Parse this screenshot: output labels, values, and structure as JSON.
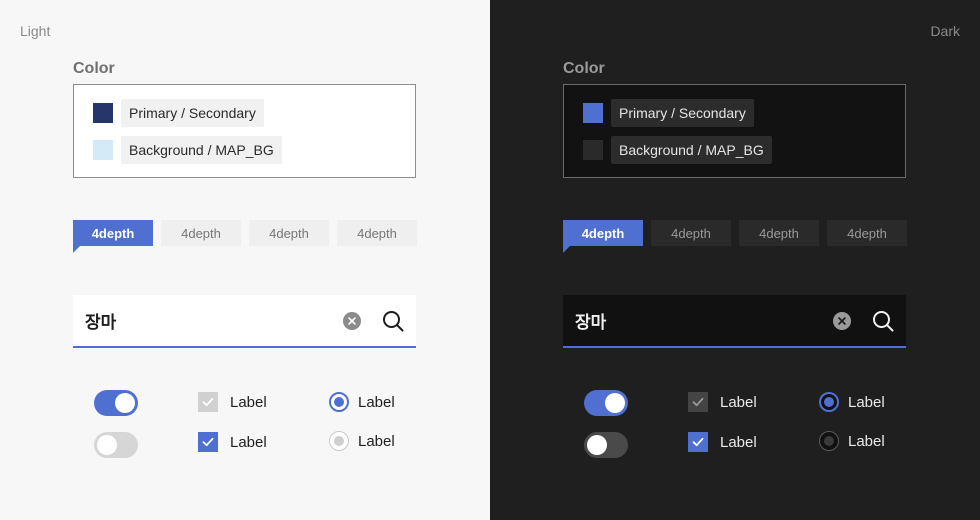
{
  "light": {
    "mode_label": "Light",
    "section_title": "Color",
    "swatches": [
      {
        "label": "Primary / Secondary",
        "color": "#27366a"
      },
      {
        "label": "Background / MAP_BG",
        "color": "#d4eaf6"
      }
    ],
    "tabs": [
      "4depth",
      "4depth",
      "4depth",
      "4depth"
    ],
    "active_tab": 0,
    "search": {
      "value": "장마"
    },
    "toggles": [
      {
        "on": true
      },
      {
        "on": false
      }
    ],
    "checkboxes": [
      {
        "label": "Label",
        "state": "disabled-checked"
      },
      {
        "label": "Label",
        "state": "checked"
      }
    ],
    "radios": [
      {
        "label": "Label",
        "selected": true
      },
      {
        "label": "Label",
        "selected": false
      }
    ]
  },
  "dark": {
    "mode_label": "Dark",
    "section_title": "Color",
    "swatches": [
      {
        "label": "Primary / Secondary",
        "color": "#4f6fd1"
      },
      {
        "label": "Background / MAP_BG",
        "color": "#2a2a2a"
      }
    ],
    "tabs": [
      "4depth",
      "4depth",
      "4depth",
      "4depth"
    ],
    "active_tab": 0,
    "search": {
      "value": "장마"
    },
    "toggles": [
      {
        "on": true
      },
      {
        "on": false
      }
    ],
    "checkboxes": [
      {
        "label": "Label",
        "state": "disabled-checked"
      },
      {
        "label": "Label",
        "state": "checked"
      }
    ],
    "radios": [
      {
        "label": "Label",
        "selected": true
      },
      {
        "label": "Label",
        "selected": false
      }
    ]
  },
  "colors": {
    "accent": "#4f6fd1"
  }
}
